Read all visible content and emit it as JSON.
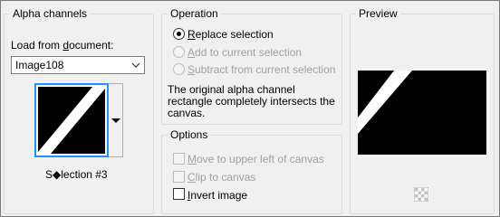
{
  "alpha": {
    "title": "Alpha channels",
    "load_label_pre": "Load from ",
    "load_label_ul": "d",
    "load_label_post": "ocument:",
    "document_value": "Image108",
    "selection_name": "S◆lection #3"
  },
  "operation": {
    "title": "Operation",
    "options": [
      {
        "pre": "",
        "ul": "R",
        "post": "eplace selection",
        "selected": true,
        "enabled": true
      },
      {
        "pre": "",
        "ul": "A",
        "post": "dd to current selection",
        "selected": false,
        "enabled": false
      },
      {
        "pre": "",
        "ul": "S",
        "post": "ubtract from current selection",
        "selected": false,
        "enabled": false
      }
    ],
    "note_line1": "The original alpha channel",
    "note_line2": "rectangle completely intersects the",
    "note_line3": "canvas."
  },
  "options": {
    "title": "Options",
    "items": [
      {
        "pre": "",
        "ul": "M",
        "post": "ove to upper left of canvas",
        "checked": false,
        "enabled": false
      },
      {
        "pre": "",
        "ul": "C",
        "post": "lip to canvas",
        "checked": false,
        "enabled": false
      },
      {
        "pre": "",
        "ul": "I",
        "post": "nvert image",
        "checked": false,
        "enabled": true
      }
    ]
  },
  "preview": {
    "title": "Preview"
  },
  "colors": {
    "focus_border": "#1e90ff",
    "disabled_text": "#a0a0a0"
  }
}
